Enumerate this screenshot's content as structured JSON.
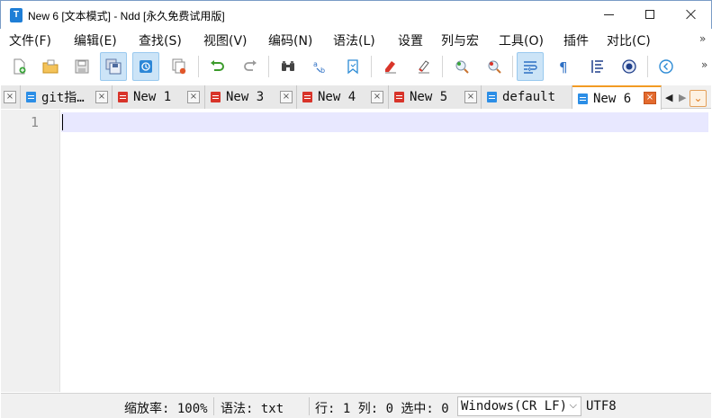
{
  "window": {
    "title": "New 6 [文本模式] - Ndd [永久免费试用版]",
    "icon_letter": "T"
  },
  "menu": {
    "items": [
      "文件(F)",
      "编辑(E)",
      "查找(S)",
      "视图(V)",
      "编码(N)",
      "语法(L)",
      "设置",
      "列与宏",
      "工具(O)",
      "插件",
      "对比(C)"
    ],
    "more": "»"
  },
  "toolbar": {
    "buttons": [
      {
        "name": "new-file-icon",
        "active": false
      },
      {
        "name": "open-file-icon",
        "active": false
      },
      {
        "name": "save-icon",
        "active": false
      },
      {
        "name": "save-all-icon",
        "active": true
      },
      {
        "name": "auto-save-icon",
        "active": true
      },
      {
        "name": "close-all-icon",
        "active": false
      },
      {
        "name": "undo-icon",
        "active": false
      },
      {
        "name": "redo-icon",
        "active": false
      },
      {
        "name": "find-icon",
        "active": false
      },
      {
        "name": "replace-icon",
        "active": false
      },
      {
        "name": "bookmark-icon",
        "active": false
      },
      {
        "name": "mark-icon",
        "active": false
      },
      {
        "name": "clear-mark-icon",
        "active": false
      },
      {
        "name": "zoom-in-icon",
        "active": false
      },
      {
        "name": "zoom-out-icon",
        "active": false
      },
      {
        "name": "word-wrap-icon",
        "active": true
      },
      {
        "name": "show-symbols-icon",
        "active": false
      },
      {
        "name": "indent-guide-icon",
        "active": false
      },
      {
        "name": "monitor-icon",
        "active": false
      },
      {
        "name": "back-icon",
        "active": false
      }
    ],
    "more": "»"
  },
  "tabs": [
    {
      "label": "",
      "icon": "none",
      "active": false
    },
    {
      "label": "git指…",
      "icon": "blue",
      "active": false
    },
    {
      "label": "New 1",
      "icon": "red",
      "active": false
    },
    {
      "label": "New 3",
      "icon": "red",
      "active": false
    },
    {
      "label": "New 4",
      "icon": "red",
      "active": false
    },
    {
      "label": "New 5",
      "icon": "red",
      "active": false
    },
    {
      "label": "default",
      "icon": "blue",
      "active": false
    },
    {
      "label": "New 6",
      "icon": "blue",
      "active": true
    }
  ],
  "tab_close_glyph": "×",
  "tab_dropdown_glyph": "⌄",
  "editor": {
    "line_numbers": [
      "1"
    ]
  },
  "status": {
    "zoom": "缩放率: 100%",
    "syntax": "语法: txt",
    "position": "行: 1 列: 0 选中: 0",
    "eol": "Windows(CR LF)",
    "encoding": "UTF8"
  },
  "colors": {
    "active_tab_accent": "#f29b23",
    "current_line": "#e8e8ff",
    "toolbar_active": "#cce4f7",
    "tab_icon_blue": "#2c8ee6",
    "tab_icon_red": "#d8342a"
  }
}
